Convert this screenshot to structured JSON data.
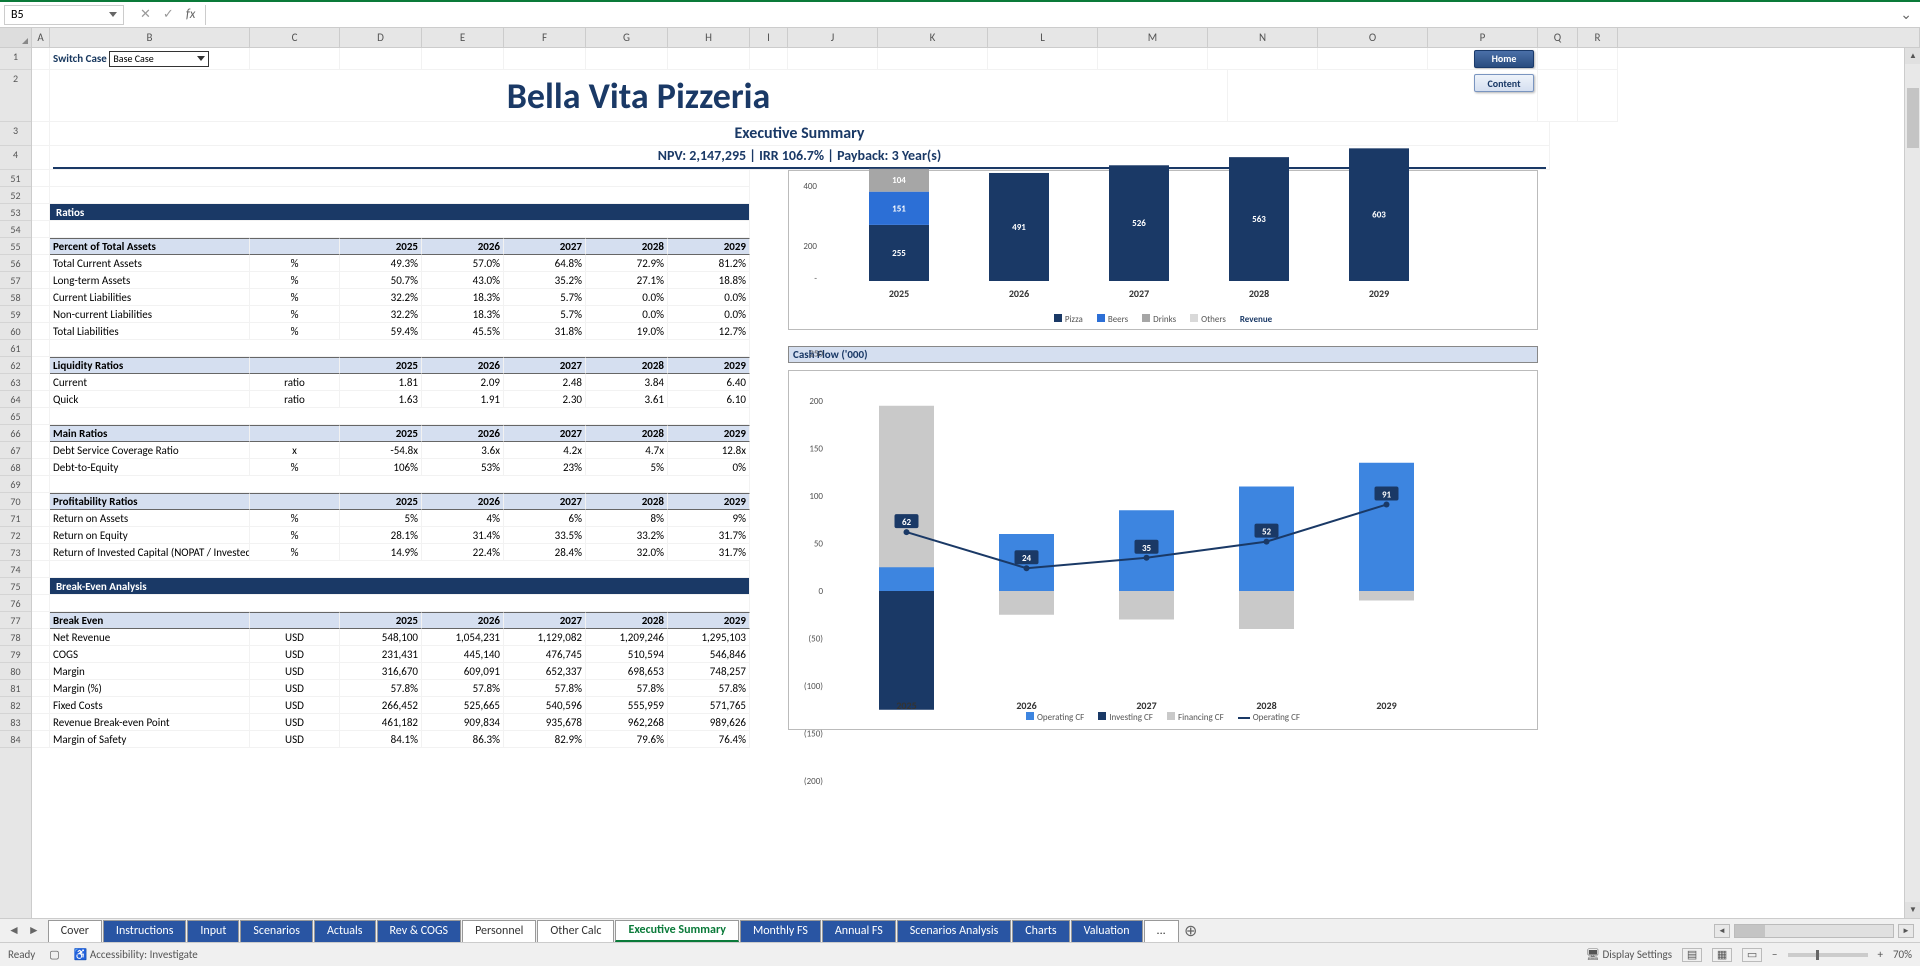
{
  "nameBox": "B5",
  "fxLabel": "fx",
  "columns": [
    "A",
    "B",
    "C",
    "D",
    "E",
    "F",
    "G",
    "H",
    "I",
    "J",
    "K",
    "L",
    "M",
    "N",
    "O",
    "P",
    "Q",
    "R"
  ],
  "rows": [
    "1",
    "2",
    "3",
    "4",
    "51",
    "52",
    "53",
    "54",
    "55",
    "56",
    "57",
    "58",
    "59",
    "60",
    "61",
    "62",
    "63",
    "64",
    "65",
    "66",
    "67",
    "68",
    "69",
    "70",
    "71",
    "72",
    "73",
    "74",
    "75",
    "76",
    "77",
    "78",
    "79",
    "80",
    "81",
    "82",
    "83",
    "84"
  ],
  "switchCase": "Switch Case",
  "caseValue": "Base Case",
  "navHome": "Home",
  "navContent": "Content",
  "title": "Bella Vita Pizzeria",
  "subtitle": "Executive Summary",
  "kpi": "NPV: 2,147,295 | IRR 106.7% | Payback: 3 Year(s)",
  "years": [
    "2025",
    "2026",
    "2027",
    "2028",
    "2029"
  ],
  "secRatios": "Ratios",
  "tblPct": {
    "head": "Percent of Total Assets",
    "rows": [
      {
        "lbl": "Total Current Assets",
        "u": "%",
        "v": [
          "49.3%",
          "57.0%",
          "64.8%",
          "72.9%",
          "81.2%"
        ]
      },
      {
        "lbl": "Long-term Assets",
        "u": "%",
        "v": [
          "50.7%",
          "43.0%",
          "35.2%",
          "27.1%",
          "18.8%"
        ]
      },
      {
        "lbl": "Current Liabilities",
        "u": "%",
        "v": [
          "32.2%",
          "18.3%",
          "5.7%",
          "0.0%",
          "0.0%"
        ]
      },
      {
        "lbl": "Non-current Liabilities",
        "u": "%",
        "v": [
          "32.2%",
          "18.3%",
          "5.7%",
          "0.0%",
          "0.0%"
        ]
      },
      {
        "lbl": "Total Liabilities",
        "u": "%",
        "v": [
          "59.4%",
          "45.5%",
          "31.8%",
          "19.0%",
          "12.7%"
        ]
      }
    ]
  },
  "tblLiq": {
    "head": "Liquidity Ratios",
    "rows": [
      {
        "lbl": "Current",
        "u": "ratio",
        "v": [
          "1.81",
          "2.09",
          "2.48",
          "3.84",
          "6.40"
        ]
      },
      {
        "lbl": "Quick",
        "u": "ratio",
        "v": [
          "1.63",
          "1.91",
          "2.30",
          "3.61",
          "6.10"
        ]
      }
    ]
  },
  "tblMain": {
    "head": "Main Ratios",
    "rows": [
      {
        "lbl": "Debt Service Coverage Ratio",
        "u": "x",
        "v": [
          "-54.8x",
          "3.6x",
          "4.2x",
          "4.7x",
          "12.8x"
        ]
      },
      {
        "lbl": "Debt-to-Equity",
        "u": "%",
        "v": [
          "106%",
          "53%",
          "23%",
          "5%",
          "0%"
        ]
      }
    ]
  },
  "tblProfit": {
    "head": "Profitability Ratios",
    "rows": [
      {
        "lbl": "Return on Assets",
        "u": "%",
        "v": [
          "5%",
          "4%",
          "6%",
          "8%",
          "9%"
        ]
      },
      {
        "lbl": "Return on Equity",
        "u": "%",
        "v": [
          "28.1%",
          "31.4%",
          "33.5%",
          "33.2%",
          "31.7%"
        ]
      },
      {
        "lbl": "Return of Invested Capital (NOPAT / Invested Capital)",
        "u": "%",
        "v": [
          "14.9%",
          "22.4%",
          "28.4%",
          "32.0%",
          "31.7%"
        ]
      }
    ]
  },
  "secBE": "Break-Even Analysis",
  "tblBE": {
    "head": "Break Even",
    "rows": [
      {
        "lbl": "Net Revenue",
        "u": "USD",
        "v": [
          "548,100",
          "1,054,231",
          "1,129,082",
          "1,209,246",
          "1,295,103"
        ]
      },
      {
        "lbl": "COGS",
        "u": "USD",
        "v": [
          "231,431",
          "445,140",
          "476,745",
          "510,594",
          "546,846"
        ]
      },
      {
        "lbl": "Margin",
        "u": "USD",
        "v": [
          "316,670",
          "609,091",
          "652,337",
          "698,653",
          "748,257"
        ]
      },
      {
        "lbl": "Margin (%)",
        "u": "USD",
        "v": [
          "57.8%",
          "57.8%",
          "57.8%",
          "57.8%",
          "57.8%"
        ]
      },
      {
        "lbl": "Fixed Costs",
        "u": "USD",
        "v": [
          "266,452",
          "525,665",
          "540,596",
          "555,959",
          "571,765"
        ]
      },
      {
        "lbl": "Revenue Break-even Point",
        "u": "USD",
        "v": [
          "461,182",
          "909,834",
          "935,678",
          "962,268",
          "989,626"
        ]
      },
      {
        "lbl": "Margin of Safety",
        "u": "USD",
        "v": [
          "84.1%",
          "86.3%",
          "82.9%",
          "79.6%",
          "76.4%"
        ]
      }
    ]
  },
  "chart_data": [
    {
      "type": "bar-stacked",
      "title": "",
      "xlabel": "",
      "ylabel": "",
      "ylim": [
        0,
        600
      ],
      "ticks": [
        200,
        400
      ],
      "categories": [
        "2025",
        "2026",
        "2027",
        "2028",
        "2029"
      ],
      "series": [
        {
          "name": "Pizza",
          "values": [
            255,
            491,
            526,
            563,
            603
          ],
          "color": "#1a3966"
        },
        {
          "name": "Beers",
          "values": [
            151,
            0,
            0,
            0,
            0
          ],
          "color": "#2c6fd6"
        },
        {
          "name": "Drinks",
          "values": [
            104,
            0,
            0,
            0,
            0
          ],
          "color": "#a6a6a6"
        },
        {
          "name": "Others",
          "values": [
            0,
            0,
            0,
            0,
            0
          ],
          "color": "#d9d9d9"
        }
      ],
      "extra_legend": "Revenue"
    },
    {
      "type": "bar-line",
      "title": "Cash Flow ('000)",
      "xlabel": "",
      "ylabel": "",
      "ylim": [
        -200,
        250
      ],
      "ticks": [
        -200,
        -150,
        -100,
        -50,
        0,
        50,
        100,
        150,
        200,
        250
      ],
      "categories": [
        "2025",
        "2026",
        "2027",
        "2028",
        "2029"
      ],
      "series": [
        {
          "name": "Operating CF",
          "type": "bar",
          "values": [
            25,
            60,
            85,
            110,
            135
          ],
          "color": "#3d85e0"
        },
        {
          "name": "Investing CF",
          "type": "bar",
          "values": [
            -125,
            0,
            0,
            0,
            0
          ],
          "color": "#1a3966"
        },
        {
          "name": "Financing CF",
          "type": "bar",
          "values": [
            195,
            -25,
            -30,
            -40,
            -10
          ],
          "color": "#c9c9c9"
        },
        {
          "name": "Operating CF",
          "type": "line",
          "values": [
            62,
            24,
            35,
            52,
            91
          ],
          "labels": [
            "62",
            "24",
            "35",
            "52",
            "91"
          ],
          "color": "#1a3966"
        }
      ]
    }
  ],
  "cfHeader": "Cash Flow ('000)",
  "sheets": [
    "Cover",
    "Instructions",
    "Input",
    "Scenarios",
    "Actuals",
    "Rev & COGS",
    "Personnel",
    "Other Calc",
    "Executive Summary",
    "Monthly FS",
    "Annual FS",
    "Scenarios Analysis",
    "Charts",
    "Valuation"
  ],
  "activeSheet": "Executive Summary",
  "plainSheets": [
    "Cover",
    "Personnel",
    "Other Calc"
  ],
  "tabMore": "...",
  "status": {
    "ready": "Ready",
    "access": "Accessibility: Investigate",
    "display": "Display Settings",
    "zoom": "70%"
  }
}
